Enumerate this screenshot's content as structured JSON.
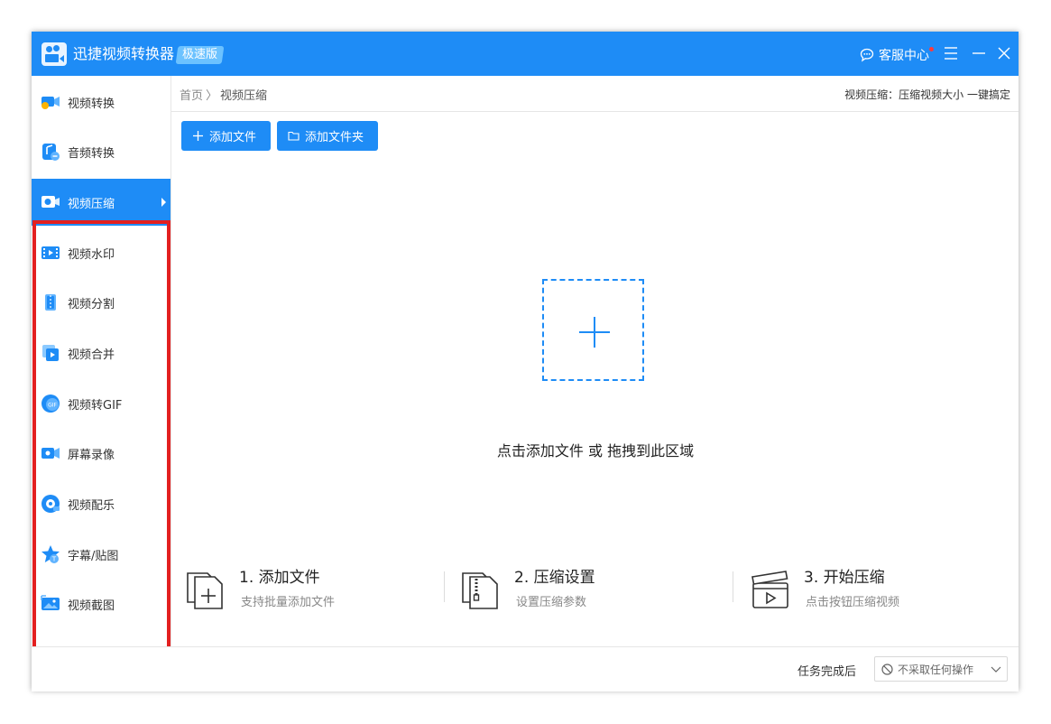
{
  "app": {
    "title": "迅捷视频转换器",
    "badge": "极速版",
    "service_label": "客服中心",
    "accent_color": "#1e8cf6"
  },
  "sidebar": {
    "items": [
      {
        "label": "视频转换",
        "icon": "video-convert-icon"
      },
      {
        "label": "音频转换",
        "icon": "audio-convert-icon"
      },
      {
        "label": "视频压缩",
        "icon": "video-compress-icon",
        "active": true
      },
      {
        "label": "视频水印",
        "icon": "video-watermark-icon"
      },
      {
        "label": "视频分割",
        "icon": "video-split-icon"
      },
      {
        "label": "视频合并",
        "icon": "video-merge-icon"
      },
      {
        "label": "视频转GIF",
        "icon": "video-gif-icon"
      },
      {
        "label": "屏幕录像",
        "icon": "screen-record-icon"
      },
      {
        "label": "视频配乐",
        "icon": "video-music-icon"
      },
      {
        "label": "字幕/贴图",
        "icon": "subtitle-sticker-icon"
      },
      {
        "label": "视频截图",
        "icon": "video-screenshot-icon"
      }
    ]
  },
  "breadcrumb": {
    "home": "首页",
    "separator": "〉",
    "current": "视频压缩"
  },
  "header": {
    "description": "视频压缩：压缩视频大小 一键搞定"
  },
  "toolbar": {
    "add_file": "添加文件",
    "add_folder": "添加文件夹"
  },
  "dropzone": {
    "hint": "点击添加文件 或 拖拽到此区域"
  },
  "steps": [
    {
      "title": "1. 添加文件",
      "subtitle": "支持批量添加文件",
      "icon": "add-file-icon"
    },
    {
      "title": "2. 压缩设置",
      "subtitle": "设置压缩参数",
      "icon": "zip-file-icon"
    },
    {
      "title": "3. 开始压缩",
      "subtitle": "点击按钮压缩视频",
      "icon": "clapperboard-icon"
    }
  ],
  "footer": {
    "after_task_label": "任务完成后",
    "after_task_value": "不采取任何操作"
  }
}
